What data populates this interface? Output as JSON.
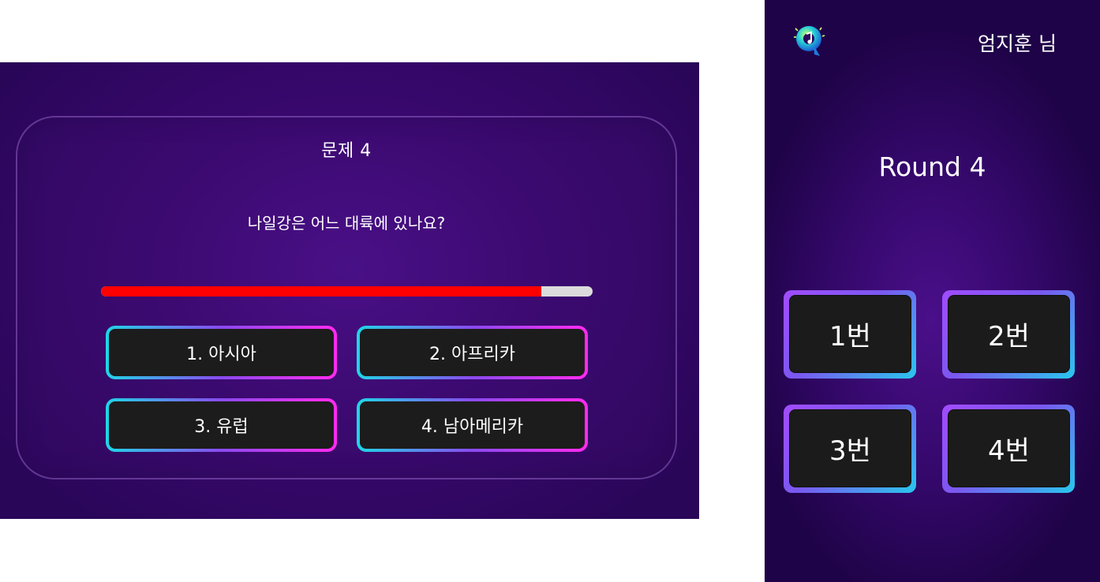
{
  "quiz": {
    "question_number": "문제 4",
    "question_text": "나일강은 어느 대륙에 있나요?",
    "timer_remaining": 0.895,
    "answers": [
      "1. 아시아",
      "2. 아프리카",
      "3. 유럽",
      "4. 남아메리카"
    ]
  },
  "controller": {
    "user_name": "엄지훈 님",
    "round_label": "Round 4",
    "buttons": [
      "1번",
      "2번",
      "3번",
      "4번"
    ],
    "logo_icon": "quiz-logo-icon"
  },
  "colors": {
    "background_purple": "#3a0870",
    "timer_fill": "#ff0000",
    "timer_track": "#dcdcdc",
    "button_face": "#1c1c1c",
    "gradient_cyan": "#1fd6e6",
    "gradient_magenta": "#ff2af0",
    "gradient_violet": "#a24cff"
  }
}
